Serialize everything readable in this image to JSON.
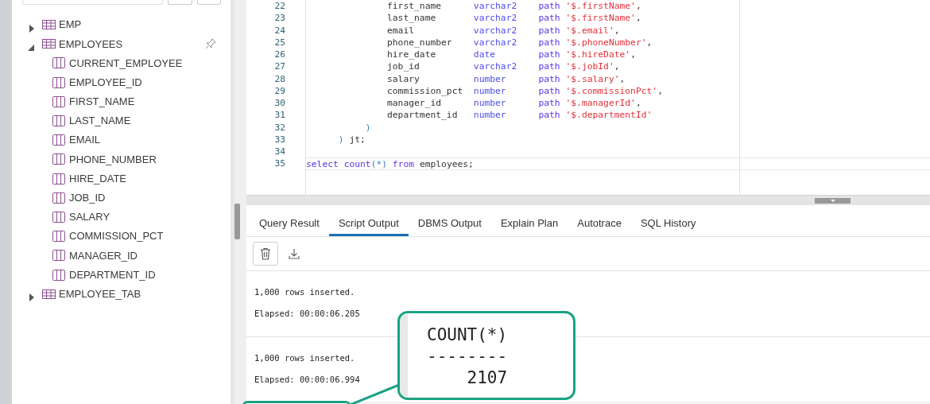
{
  "sidebar": {
    "tree": [
      {
        "label": "EMP",
        "kind": "table",
        "expanded": false,
        "pinned": false
      },
      {
        "label": "EMPLOYEES",
        "kind": "table",
        "expanded": true,
        "pinned": true,
        "children": [
          {
            "label": "CURRENT_EMPLOYEE",
            "kind": "column"
          },
          {
            "label": "EMPLOYEE_ID",
            "kind": "column"
          },
          {
            "label": "FIRST_NAME",
            "kind": "column"
          },
          {
            "label": "LAST_NAME",
            "kind": "column"
          },
          {
            "label": "EMAIL",
            "kind": "column"
          },
          {
            "label": "PHONE_NUMBER",
            "kind": "column"
          },
          {
            "label": "HIRE_DATE",
            "kind": "column"
          },
          {
            "label": "JOB_ID",
            "kind": "column"
          },
          {
            "label": "SALARY",
            "kind": "column"
          },
          {
            "label": "COMMISSION_PCT",
            "kind": "column"
          },
          {
            "label": "MANAGER_ID",
            "kind": "column"
          },
          {
            "label": "DEPARTMENT_ID",
            "kind": "column"
          }
        ]
      },
      {
        "label": "EMPLOYEE_TAB",
        "kind": "table",
        "expanded": false,
        "pinned": false
      }
    ]
  },
  "editor": {
    "lines": [
      {
        "number": "22",
        "kind": "column_def",
        "name": "first_name",
        "type": "varchar2",
        "keyword": "path",
        "string": "'$.firstName'",
        "punct": ","
      },
      {
        "number": "23",
        "kind": "column_def",
        "name": "last_name",
        "type": "varchar2",
        "keyword": "path",
        "string": "'$.firstName'",
        "punct": ","
      },
      {
        "number": "24",
        "kind": "column_def",
        "name": "email",
        "type": "varchar2",
        "keyword": "path",
        "string": "'$.email'",
        "punct": ","
      },
      {
        "number": "25",
        "kind": "column_def",
        "name": "phone_number",
        "type": "varchar2",
        "keyword": "path",
        "string": "'$.phoneNumber'",
        "punct": ","
      },
      {
        "number": "26",
        "kind": "column_def",
        "name": "hire_date",
        "type": "date",
        "keyword": "path",
        "string": "'$.hireDate'",
        "punct": ","
      },
      {
        "number": "27",
        "kind": "column_def",
        "name": "job_id",
        "type": "varchar2",
        "keyword": "path",
        "string": "'$.jobId'",
        "punct": ","
      },
      {
        "number": "28",
        "kind": "column_def",
        "name": "salary",
        "type": "number",
        "keyword": "path",
        "string": "'$.salary'",
        "punct": ","
      },
      {
        "number": "29",
        "kind": "column_def",
        "name": "commission_pct",
        "type": "number",
        "keyword": "path",
        "string": "'$.commissionPct'",
        "punct": ","
      },
      {
        "number": "30",
        "kind": "column_def",
        "name": "manager_id",
        "type": "number",
        "keyword": "path",
        "string": "'$.managerId'",
        "punct": ","
      },
      {
        "number": "31",
        "kind": "column_def",
        "name": "department_id",
        "type": "number",
        "keyword": "path",
        "string": "'$.departmentId'"
      },
      {
        "number": "32",
        "kind": "inner_close",
        "current": false,
        "tokens": [
          {
            "text": ")",
            "kind": "paren"
          }
        ]
      },
      {
        "number": "33",
        "kind": "outer_close",
        "current": false,
        "tokens": [
          {
            "text": ")",
            "kind": "paren"
          },
          {
            "text": "jt;",
            "kind": "plain"
          }
        ]
      },
      {
        "number": "34",
        "kind": "blank"
      },
      {
        "number": "35",
        "kind": "statement",
        "current": true,
        "tokens": [
          {
            "text": "select",
            "kind": "keyword"
          },
          {
            "text": "count",
            "kind": "keyword"
          },
          {
            "text": "(*)",
            "kind": "args"
          },
          {
            "text": "from",
            "kind": "keyword"
          },
          {
            "text": "employees;",
            "kind": "plain"
          }
        ]
      }
    ]
  },
  "output_tabs": [
    {
      "label": "Query Result",
      "selected": false
    },
    {
      "label": "Script Output",
      "selected": true
    },
    {
      "label": "DBMS Output",
      "selected": false
    },
    {
      "label": "Explain Plan",
      "selected": false
    },
    {
      "label": "Autotrace",
      "selected": false
    },
    {
      "label": "SQL History",
      "selected": false
    }
  ],
  "output": {
    "blocks": [
      {
        "lines": [
          "1,000 rows inserted.",
          "Elapsed: 00:00:06.205"
        ]
      },
      {
        "lines": [
          "1,000 rows inserted.",
          "Elapsed: 00:00:06.994"
        ]
      }
    ]
  },
  "callout": {
    "lines": [
      "COUNT(*)",
      "--------",
      "    2107"
    ]
  }
}
